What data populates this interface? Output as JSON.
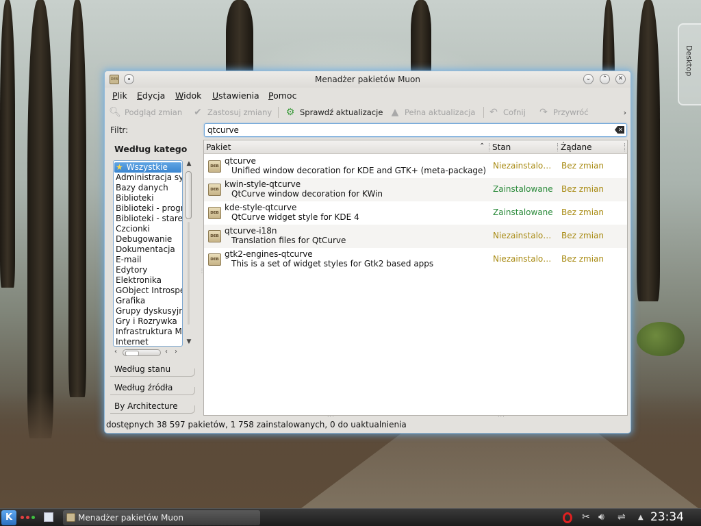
{
  "desktop": {
    "tab_label": "Desktop"
  },
  "window": {
    "title": "Menadżer pakietów Muon",
    "icon_text": "DEB"
  },
  "menubar": {
    "items": [
      {
        "label": "Plik"
      },
      {
        "label": "Edycja"
      },
      {
        "label": "Widok"
      },
      {
        "label": "Ustawienia"
      },
      {
        "label": "Pomoc"
      }
    ]
  },
  "toolbar": {
    "preview": "Podgląd zmian",
    "apply": "Zastosuj zmiany",
    "check_updates": "Sprawdź aktualizacje",
    "full_upgrade": "Pełna aktualizacja",
    "undo": "Cofnij",
    "redo": "Przywróć",
    "more": "›"
  },
  "filter": {
    "label": "Filtr:",
    "by_category": "Według kategorii",
    "categories": [
      "Wszystkie",
      "Administracja systemu",
      "Bazy danych",
      "Biblioteki",
      "Biblioteki - programistyczne",
      "Biblioteki - stare",
      "Czcionki",
      "Debugowanie",
      "Dokumentacja",
      "E-mail",
      "Edytory",
      "Elektronika",
      "GObject Introspection",
      "Grafika",
      "Grupy dyskusyjne",
      "Gry i Rozrywka",
      "Infrastruktura Mono",
      "Internet"
    ],
    "by_state": "Według stanu",
    "by_source": "Według źródła",
    "by_arch": "By Architecture"
  },
  "search": {
    "value": "qtcurve"
  },
  "table": {
    "columns": {
      "package": "Pakiet",
      "state": "Stan",
      "requested": "Żądane"
    },
    "rows": [
      {
        "name": "qtcurve",
        "desc": "Unified window decoration for KDE and GTK+ (meta-package)",
        "state": "Niezainstalowane",
        "requested": "Bez zmian",
        "installed": false
      },
      {
        "name": "kwin-style-qtcurve",
        "desc": "QtCurve window decoration for KWin",
        "state": "Zainstalowane",
        "requested": "Bez zmian",
        "installed": true
      },
      {
        "name": "kde-style-qtcurve",
        "desc": "QtCurve widget style for KDE 4",
        "state": "Zainstalowane",
        "requested": "Bez zmian",
        "installed": true
      },
      {
        "name": "qtcurve-i18n",
        "desc": "Translation files for QtCurve",
        "state": "Niezainstalowane",
        "requested": "Bez zmian",
        "installed": false
      },
      {
        "name": "gtk2-engines-qtcurve",
        "desc": "This is a set of widget styles for Gtk2 based apps",
        "state": "Niezainstalowane",
        "requested": "Bez zmian",
        "installed": false
      }
    ]
  },
  "statusbar": {
    "text": "dostępnych 38 597 pakietów, 1 758 zainstalowanych, 0 do uaktualnienia"
  },
  "taskbar": {
    "kicker_label": "K",
    "task_title": "Menadżer pakietów Muon",
    "clock": "23:34"
  },
  "colors": {
    "not_installed": "#a88a12",
    "installed": "#2a8a3a",
    "selection": "#3b86d0",
    "window_glow": "#64aae6"
  }
}
